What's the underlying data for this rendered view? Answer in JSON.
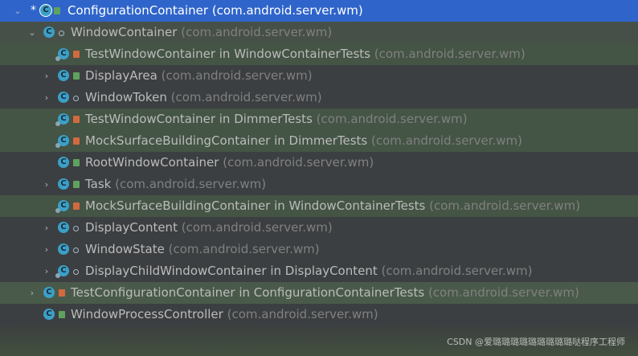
{
  "colors": {
    "selection": "#2f65ca",
    "row_highlight": "#445445",
    "text": "#bbbbbb",
    "package_text": "#808080",
    "class_icon": "#3aa0c8"
  },
  "tree": [
    {
      "class_name": "ConfigurationContainer",
      "package": "(com.android.server.wm)"
    },
    {
      "class_name": "WindowContainer",
      "package": "(com.android.server.wm)"
    },
    {
      "class_name": "TestWindowContainer in WindowContainerTests",
      "package": "(com.android.server.wm)"
    },
    {
      "class_name": "DisplayArea",
      "package": "(com.android.server.wm)"
    },
    {
      "class_name": "WindowToken",
      "package": "(com.android.server.wm)"
    },
    {
      "class_name": "TestWindowContainer in DimmerTests",
      "package": "(com.android.server.wm)"
    },
    {
      "class_name": "MockSurfaceBuildingContainer in DimmerTests",
      "package": "(com.android.server.wm)"
    },
    {
      "class_name": "RootWindowContainer",
      "package": "(com.android.server.wm)"
    },
    {
      "class_name": "Task",
      "package": "(com.android.server.wm)"
    },
    {
      "class_name": "MockSurfaceBuildingContainer in WindowContainerTests",
      "package": "(com.android.server.wm)"
    },
    {
      "class_name": "DisplayContent",
      "package": "(com.android.server.wm)"
    },
    {
      "class_name": "WindowState",
      "package": "(com.android.server.wm)"
    },
    {
      "class_name": "DisplayChildWindowContainer in DisplayContent",
      "package": "(com.android.server.wm)"
    },
    {
      "class_name": "TestConfigurationContainer in ConfigurationContainerTests",
      "package": "(com.android.server.wm)"
    },
    {
      "class_name": "WindowProcessController",
      "package": "(com.android.server.wm)"
    }
  ],
  "glyphs": {
    "expanded": "⌄",
    "collapsed": "›",
    "star": "*",
    "class_letter": "C"
  },
  "watermark": "CSDN @爱璐璐璐璐璐璐璐璐璐哒程序工程师"
}
